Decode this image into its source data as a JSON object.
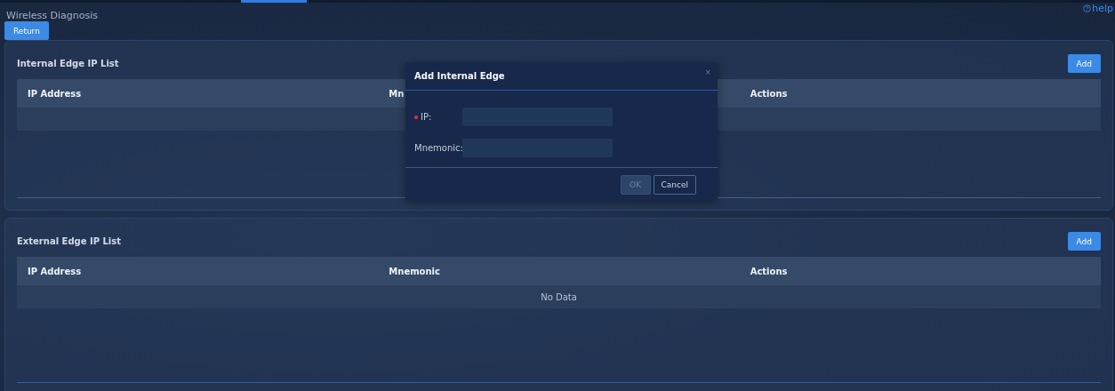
{
  "page": {
    "title": "Wireless Diagnosis",
    "help": "help"
  },
  "return_button": "Return",
  "panels": [
    {
      "title": "Internal Edge IP List",
      "add_button": "Add",
      "columns": [
        "IP Address",
        "Mn",
        "Actions"
      ]
    },
    {
      "title": "External Edge IP List",
      "add_button": "Add",
      "columns": [
        "IP Address",
        "Mnemonic",
        "Actions"
      ],
      "empty_text": "No Data"
    }
  ],
  "dialog": {
    "title": "Add Internal Edge",
    "close": "×",
    "fields": [
      {
        "label": "IP:",
        "required": true
      },
      {
        "label": "Mnemonic:",
        "required": false
      }
    ],
    "buttons": [
      {
        "label": "OK",
        "disabled": true
      },
      {
        "label": "Cancel",
        "disabled": false
      }
    ]
  }
}
